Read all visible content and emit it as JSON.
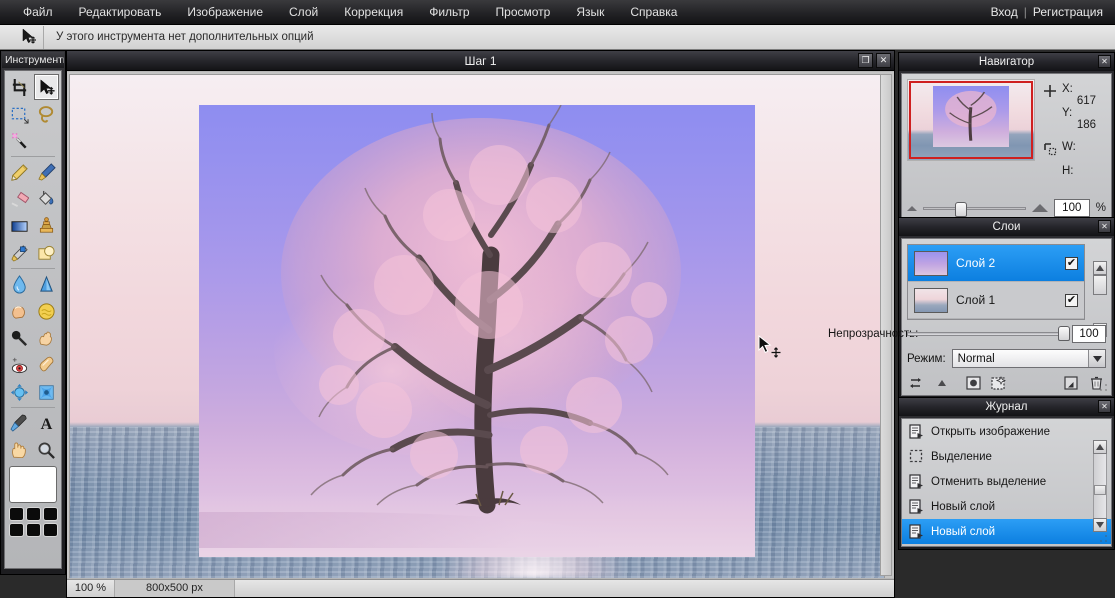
{
  "menu": {
    "items": [
      "Файл",
      "Редактировать",
      "Изображение",
      "Слой",
      "Коррекция",
      "Фильтр",
      "Просмотр",
      "Язык",
      "Справка"
    ],
    "login": "Вход",
    "separator": "|",
    "register": "Регистрация"
  },
  "options_bar": {
    "tool_icon": "move-tool-icon",
    "text": "У этого инструмента нет дополнительных опций"
  },
  "toolbox": {
    "title": "Инструменты",
    "tools": [
      {
        "name": "crop-tool",
        "active": false
      },
      {
        "name": "move-tool",
        "active": true
      },
      {
        "name": "marquee-select-tool",
        "active": false
      },
      {
        "name": "lasso-tool",
        "active": false
      },
      {
        "name": "magic-wand-tool",
        "active": false
      },
      {
        "name": "pencil-tool",
        "active": false
      },
      {
        "name": "brush-tool",
        "active": false
      },
      {
        "name": "eraser-tool",
        "active": false
      },
      {
        "name": "paint-bucket-tool",
        "active": false
      },
      {
        "name": "gradient-tool",
        "active": false
      },
      {
        "name": "clone-stamp-tool",
        "active": false
      },
      {
        "name": "replace-color-tool",
        "active": false
      },
      {
        "name": "shape-tool",
        "active": false
      },
      {
        "name": "blur-tool",
        "active": false
      },
      {
        "name": "sharpen-tool",
        "active": false
      },
      {
        "name": "smudge-tool",
        "active": false
      },
      {
        "name": "sponge-tool",
        "active": false
      },
      {
        "name": "dodge-burn-tool",
        "active": false
      },
      {
        "name": "hand-smudge-tool",
        "active": false
      },
      {
        "name": "red-eye-tool",
        "active": false
      },
      {
        "name": "spot-heal-tool",
        "active": false
      },
      {
        "name": "bloat-tool",
        "active": false
      },
      {
        "name": "pinch-tool",
        "active": false
      },
      {
        "name": "eyedropper-tool",
        "active": false
      },
      {
        "name": "type-tool",
        "active": false
      },
      {
        "name": "hand-tool",
        "active": false
      },
      {
        "name": "zoom-tool",
        "active": false
      }
    ],
    "foreground_color": "#ffffff",
    "palette_colors": [
      "#0b0b0b",
      "#0b0b0b",
      "#0b0b0b",
      "#0b0b0b",
      "#0b0b0b",
      "#0b0b0b"
    ]
  },
  "document": {
    "title": "Шаг 1",
    "restore_label": "❐",
    "close_label": "✕",
    "status": {
      "zoom": "100 %",
      "size": "800x500 px"
    }
  },
  "navigator": {
    "title": "Навигатор",
    "close_label": "✕",
    "x_label": "X:",
    "x_value": "617",
    "y_label": "Y:",
    "y_value": "186",
    "w_label": "W:",
    "w_value": "",
    "h_label": "H:",
    "h_value": "",
    "zoom_value": "100",
    "percent": "%"
  },
  "layers": {
    "title": "Слои",
    "close_label": "✕",
    "items": [
      {
        "name": "Слой 2",
        "visible": true,
        "selected": true,
        "check": "✔"
      },
      {
        "name": "Слой 1",
        "visible": true,
        "selected": false,
        "check": "✔"
      }
    ],
    "opacity_label": "Непрозрачность:",
    "opacity_value": "100",
    "mode_label": "Режим:",
    "mode_value": "Normal",
    "tools": [
      "layer-properties-icon",
      "layer-expand-icon",
      "layer-mask-icon",
      "new-layer-icon",
      "duplicate-layer-icon",
      "delete-layer-icon"
    ]
  },
  "history": {
    "title": "Журнал",
    "close_label": "✕",
    "items": [
      {
        "label": "Открыть изображение",
        "icon": "document-icon",
        "selected": false
      },
      {
        "label": "Выделение",
        "icon": "selection-icon",
        "selected": false
      },
      {
        "label": "Отменить выделение",
        "icon": "document-icon",
        "selected": false
      },
      {
        "label": "Новый слой",
        "icon": "document-icon",
        "selected": false
      },
      {
        "label": "Новый слой",
        "icon": "document-icon",
        "selected": true
      }
    ]
  },
  "colors": {
    "accent": "#0c7fe0",
    "panel_title_dark": "#25252a",
    "panel_body": "#c9cacd",
    "nav_view_box": "#cf2020"
  }
}
